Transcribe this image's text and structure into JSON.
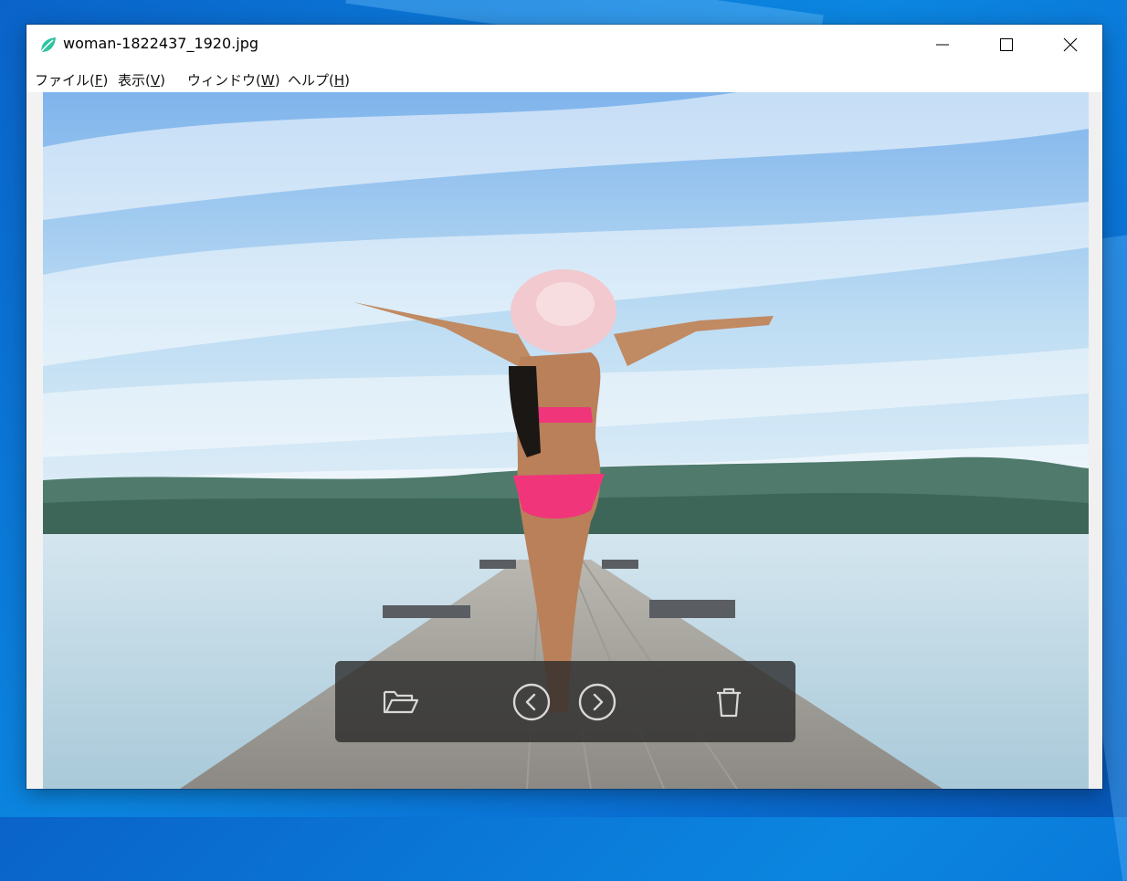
{
  "window": {
    "title": "woman-1822437_1920.jpg"
  },
  "menu": {
    "file": {
      "label": "ファイル(",
      "mnemonic": "F",
      "close": ")"
    },
    "view": {
      "label": "表示(",
      "mnemonic": "V",
      "close": ")"
    },
    "window": {
      "label": "ウィンドウ(",
      "mnemonic": "W",
      "close": ")"
    },
    "help": {
      "label": "ヘルプ(",
      "mnemonic": "H",
      "close": ")"
    }
  },
  "toolbar": {
    "open_icon": "folder-open-icon",
    "prev_icon": "chevron-left-circle-icon",
    "next_icon": "chevron-right-circle-icon",
    "delete_icon": "trash-icon"
  },
  "colors": {
    "app_icon": "#2ec4a0",
    "toolbar_bg": "#282828"
  }
}
